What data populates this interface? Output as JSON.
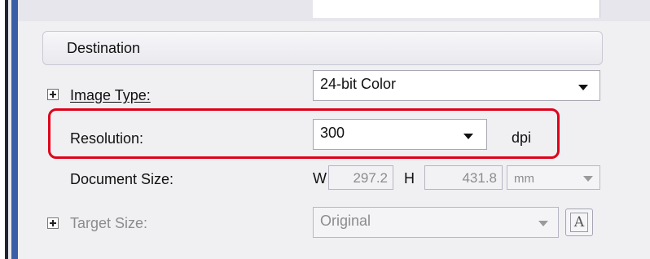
{
  "destination": {
    "section_title": "Destination",
    "image_type": {
      "label": "Image Type:",
      "value": "24-bit Color"
    },
    "resolution": {
      "label": "Resolution:",
      "value": "300",
      "unit": "dpi"
    },
    "document_size": {
      "label": "Document Size:",
      "w_label": "W",
      "w_value": "297.2",
      "h_label": "H",
      "h_value": "431.8",
      "unit_value": "mm"
    },
    "target_size": {
      "label": "Target Size:",
      "value": "Original",
      "font_button_glyph": "A"
    }
  },
  "colors": {
    "highlight": "#e0001a",
    "panel": "#f0f0f3",
    "disabled_text": "#8c8c8c"
  }
}
